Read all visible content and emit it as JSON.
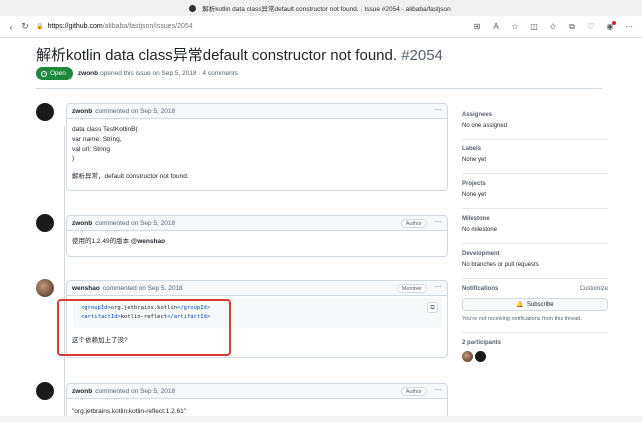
{
  "browser": {
    "window_title": "解析kotlin data class异常default constructor not found. · Issue #2054 · alibaba/fastjson",
    "url_host": "https://github.com",
    "url_path": "/alibaba/fastjson/issues/2054",
    "back_icon": "arrow-left-icon",
    "reload_icon": "reload-icon",
    "toolbar_icons": [
      "grid-icon",
      "star-icon",
      "read-aloud-icon",
      "split-screen-icon",
      "favorites-icon",
      "collections-icon",
      "heart-icon",
      "profile-icon",
      "more-icon"
    ]
  },
  "issue": {
    "title": "解析kotlin data class异常default constructor not found.",
    "number": "#2054",
    "status": "Open",
    "author": "zwonb",
    "opened_text": "opened this issue on Sep 5, 2018 · 4 comments"
  },
  "comments": [
    {
      "author": "zwonb",
      "meta": "commented on Sep 5, 2018",
      "role": "",
      "lines": [
        "data class TestKotlinB(",
        "var name: String,",
        "val url: String",
        ")",
        "解析异常，default constructor not found."
      ]
    },
    {
      "author": "zwonb",
      "meta": "commented on Sep 5, 2018",
      "role": "Author",
      "text_before": "使用的1.2.49的版本 ",
      "mention": "@wenshao"
    },
    {
      "author": "wenshao",
      "meta": "commented on Sep 5, 2018",
      "role": "Member",
      "code": [
        {
          "open": "<groupId>",
          "text": "org.jetbrains.kotlin",
          "close": "</groupId>"
        },
        {
          "open": "<artifactId>",
          "text": "kotlin-reflect",
          "close": "</artifactId>"
        }
      ],
      "text": "这个依赖加上了没?"
    },
    {
      "author": "zwonb",
      "meta": "commented on Sep 5, 2018",
      "role": "Author",
      "text": "\"org.jetbrains.kotlin:kotlin-reflect:1.2.61\""
    }
  ],
  "sidebar": {
    "assignees": {
      "title": "Assignees",
      "value": "No one assigned"
    },
    "labels": {
      "title": "Labels",
      "value": "None yet"
    },
    "projects": {
      "title": "Projects",
      "value": "None yet"
    },
    "milestone": {
      "title": "Milestone",
      "value": "No milestone"
    },
    "development": {
      "title": "Development",
      "value": "No branches or pull requests"
    },
    "notifications": {
      "title": "Notifications",
      "customize": "Customize",
      "button": "Subscribe",
      "note": "You're not receiving notifications from this thread."
    },
    "participants": {
      "title": "2 participants"
    }
  },
  "colors": {
    "open_green": "#1f883d",
    "highlight_red": "#d63a3a",
    "code_tag_blue": "#0550ae"
  }
}
